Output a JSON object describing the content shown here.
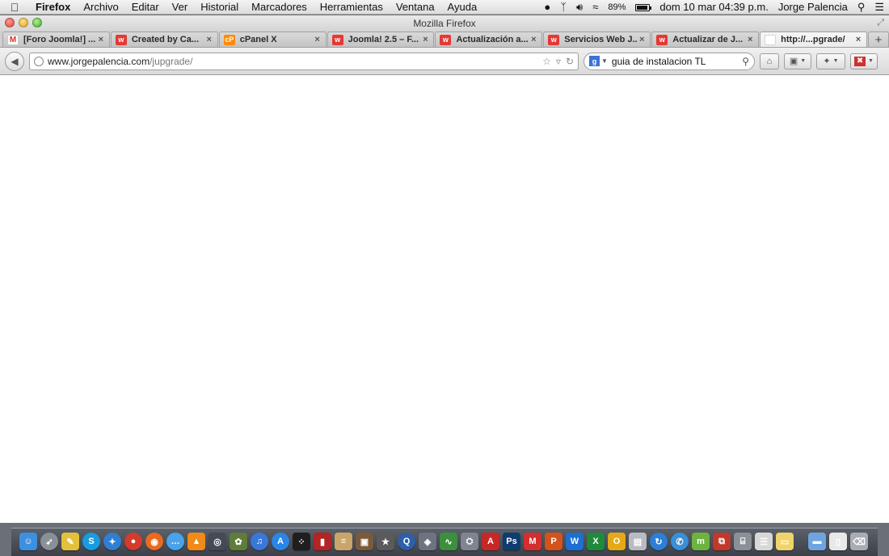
{
  "menubar": {
    "apple_icon": "apple-icon",
    "app_name": "Firefox",
    "menus": [
      "Archivo",
      "Editar",
      "Ver",
      "Historial",
      "Marcadores",
      "Herramientas",
      "Ventana",
      "Ayuda"
    ],
    "battery": "89%",
    "battery_level": 0.89,
    "datetime": "dom 10 mar  04:39 p.m.",
    "user": "Jorge Palencia"
  },
  "window": {
    "title": "Mozilla Firefox"
  },
  "tabs": [
    {
      "label": "[Foro Joomla!] ...",
      "favicon": "gmail-icon",
      "favicon_text": "M",
      "active": false
    },
    {
      "label": "Created by Ca...",
      "favicon": "w-icon",
      "favicon_text": "w",
      "active": false
    },
    {
      "label": "cPanel X",
      "favicon": "cpanel-icon",
      "favicon_text": "cP",
      "active": false
    },
    {
      "label": "Joomla! 2.5 – F...",
      "favicon": "w-icon",
      "favicon_text": "w",
      "active": false
    },
    {
      "label": "Actualización a...",
      "favicon": "w-icon",
      "favicon_text": "w",
      "active": false
    },
    {
      "label": "Servicios Web J...",
      "favicon": "w-icon",
      "favicon_text": "w",
      "active": false
    },
    {
      "label": "Actualizar de J...",
      "favicon": "w-icon",
      "favicon_text": "w",
      "active": false
    },
    {
      "label": "http://...pgrade/",
      "favicon": "blank-page-icon",
      "favicon_text": "",
      "active": true
    }
  ],
  "new_tab_label": "+",
  "address": {
    "domain": "www.jorgepalencia.com",
    "path": "/jupgrade/"
  },
  "search": {
    "engine_letter": "g",
    "query": "guia de instalacion TL"
  },
  "colors": {
    "accent_red": "#d32f2f",
    "tab_w_red": "#e53935",
    "cpanel_orange": "#ff8a00"
  },
  "dock_apps": [
    {
      "name": "finder-icon",
      "glyph": "☺",
      "color": "#3d8fe0",
      "round": false
    },
    {
      "name": "launchpad-icon",
      "glyph": "➶",
      "color": "#8a8f98",
      "round": true
    },
    {
      "name": "notes-icon",
      "glyph": "✎",
      "color": "#e3c13b",
      "round": false
    },
    {
      "name": "skype-icon",
      "glyph": "S",
      "color": "#1a9be0",
      "round": true
    },
    {
      "name": "safari-icon",
      "glyph": "✦",
      "color": "#2f7fd2",
      "round": true
    },
    {
      "name": "chrome-icon",
      "glyph": "●",
      "color": "#d33b2c",
      "round": true
    },
    {
      "name": "firefox-icon",
      "glyph": "◉",
      "color": "#e86b1f",
      "round": true
    },
    {
      "name": "messages-icon",
      "glyph": "…",
      "color": "#4aa3ea",
      "round": true
    },
    {
      "name": "vlc-icon",
      "glyph": "▲",
      "color": "#f08a1b",
      "round": false
    },
    {
      "name": "camera-icon",
      "glyph": "◎",
      "color": "#444b55",
      "round": false
    },
    {
      "name": "iphoto-icon",
      "glyph": "✿",
      "color": "#5f7c3a",
      "round": false
    },
    {
      "name": "itunes-icon",
      "glyph": "♫",
      "color": "#3a78d8",
      "round": true
    },
    {
      "name": "app-store-icon",
      "glyph": "A",
      "color": "#2a86e6",
      "round": true
    },
    {
      "name": "blackberry-icon",
      "glyph": "⁘",
      "color": "#1f1f1f",
      "round": false
    },
    {
      "name": "red-book-icon",
      "glyph": "▮",
      "color": "#b32424",
      "round": false
    },
    {
      "name": "scroll-icon",
      "glyph": "≡",
      "color": "#c8a56a",
      "round": false
    },
    {
      "name": "photo-icon",
      "glyph": "▣",
      "color": "#7a5a38",
      "round": false
    },
    {
      "name": "star-icon",
      "glyph": "★",
      "color": "#5a5a5a",
      "round": false
    },
    {
      "name": "quicktime-icon",
      "glyph": "Q",
      "color": "#2d5fa8",
      "round": true
    },
    {
      "name": "preview-icon",
      "glyph": "◈",
      "color": "#6d7480",
      "round": false
    },
    {
      "name": "activity-icon",
      "glyph": "∿",
      "color": "#3c8f3c",
      "round": false
    },
    {
      "name": "disk-utility-icon",
      "glyph": "⛭",
      "color": "#7f858e",
      "round": false
    },
    {
      "name": "acrobat-icon",
      "glyph": "A",
      "color": "#c62828",
      "round": false
    },
    {
      "name": "photoshop-icon",
      "glyph": "Ps",
      "color": "#0f3d6e",
      "round": false
    },
    {
      "name": "mail-m-icon",
      "glyph": "M",
      "color": "#d32f2f",
      "round": false
    },
    {
      "name": "powerpoint-icon",
      "glyph": "P",
      "color": "#d2531c",
      "round": false
    },
    {
      "name": "word-icon",
      "glyph": "W",
      "color": "#1e6fd0",
      "round": false
    },
    {
      "name": "excel-icon",
      "glyph": "X",
      "color": "#1f8a3b",
      "round": false
    },
    {
      "name": "outlook-icon",
      "glyph": "O",
      "color": "#e6a817",
      "round": false
    },
    {
      "name": "document-icon",
      "glyph": "▤",
      "color": "#b8bcc2",
      "round": false
    },
    {
      "name": "sync-icon",
      "glyph": "↻",
      "color": "#2b7fd6",
      "round": true
    },
    {
      "name": "chat-icon",
      "glyph": "✆",
      "color": "#3a8fd8",
      "round": true
    },
    {
      "name": "movistar-icon",
      "glyph": "m",
      "color": "#6db33f",
      "round": false
    },
    {
      "name": "remote-desktop-icon",
      "glyph": "⧉",
      "color": "#c0392b",
      "round": false
    },
    {
      "name": "camera-app-icon",
      "glyph": "⌸",
      "color": "#8a8f98",
      "round": false
    },
    {
      "name": "textedit-icon",
      "glyph": "☰",
      "color": "#d8d8d8",
      "round": false
    },
    {
      "name": "stickies-icon",
      "glyph": "▭",
      "color": "#f1d36b",
      "round": false
    },
    {
      "name": "folder-icon",
      "glyph": "▬",
      "color": "#6fa4e0",
      "round": false
    },
    {
      "name": "documents-folder-icon",
      "glyph": "▯",
      "color": "#e8e8e8",
      "round": false
    },
    {
      "name": "trash-icon",
      "glyph": "⌫",
      "color": "#a9adb3",
      "round": false
    }
  ]
}
